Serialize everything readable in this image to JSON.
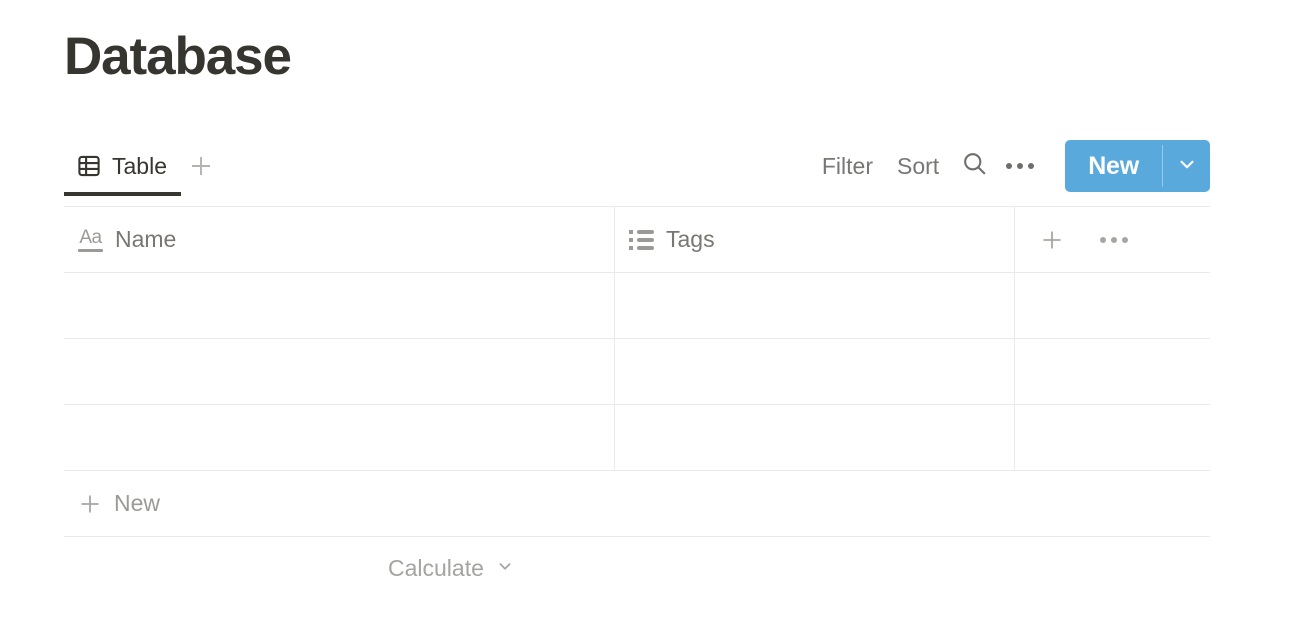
{
  "page": {
    "title": "Database"
  },
  "toolbar": {
    "tabs": [
      {
        "label": "Table",
        "icon": "table-grid-icon",
        "active": true
      }
    ],
    "add_view_icon": "plus-icon",
    "filter_label": "Filter",
    "sort_label": "Sort",
    "search_icon": "search-icon",
    "more_icon": "ellipsis-icon",
    "new_button": {
      "label": "New",
      "caret_icon": "chevron-down-icon",
      "color": "#5aa9dd",
      "text_color": "#ffffff"
    }
  },
  "table": {
    "columns": [
      {
        "name": "Name",
        "icon": "title-text-icon",
        "icon_label": "Aa",
        "type": "title"
      },
      {
        "name": "Tags",
        "icon": "multi-select-list-icon",
        "type": "multi_select"
      }
    ],
    "header_actions": {
      "add_property_icon": "plus-icon",
      "more_options_icon": "ellipsis-icon"
    },
    "rows": [
      {
        "Name": "",
        "Tags": ""
      },
      {
        "Name": "",
        "Tags": ""
      },
      {
        "Name": "",
        "Tags": ""
      }
    ],
    "new_row": {
      "label": "New",
      "icon": "plus-icon"
    },
    "footer": {
      "calculate_label": "Calculate",
      "caret_icon": "chevron-down-icon"
    }
  },
  "colors": {
    "text_primary": "#37352f",
    "text_secondary": "#787774",
    "text_muted": "#9b9a97",
    "border": "#eaeaea",
    "accent": "#5aa9dd",
    "background": "#ffffff"
  }
}
